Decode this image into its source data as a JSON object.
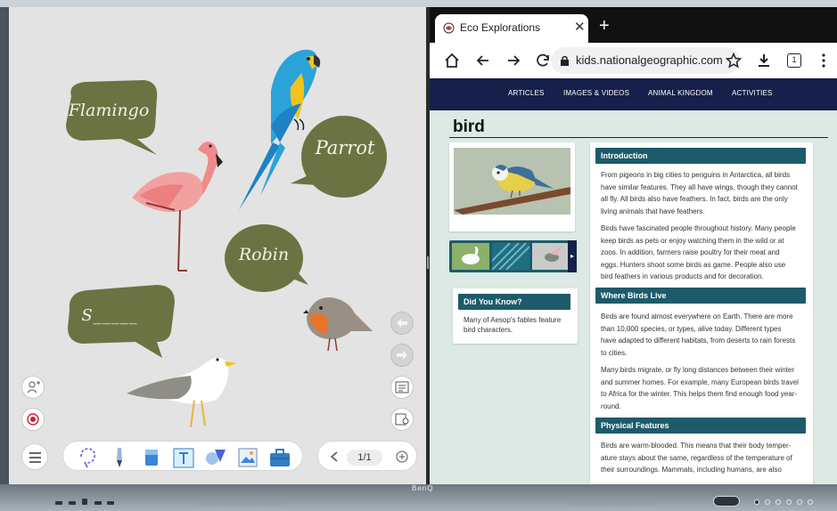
{
  "whiteboard": {
    "bubbles": [
      "Flamingo",
      "Parrot",
      "Robin",
      "S_____"
    ],
    "page_indicator": "1/1",
    "colors": {
      "bubble": "#6c7343",
      "bubble_text": "#f4f1e6"
    },
    "icons": {
      "add_user": "add-user-icon",
      "record": "record-icon",
      "undo": "undo-icon",
      "redo": "redo-icon",
      "reader": "reader-icon",
      "map": "map-icon",
      "menu": "menu-icon",
      "prev": "chevron-left-icon",
      "add_page": "add-page-icon"
    },
    "tools": [
      "lasso-tool",
      "pen-tool",
      "eraser-tool",
      "text-tool",
      "shape-tool",
      "image-tool",
      "toolbox-tool"
    ]
  },
  "browser": {
    "tab_title": "Eco Explorations",
    "url": "kids.nationalgeographic.com",
    "tab_count": "1",
    "nav": [
      "ARTICLES",
      "IMAGES & VIDEOS",
      "ANIMAL KINGDOM",
      "ACTIVITIES"
    ],
    "page_title": "bird",
    "did_you_know": {
      "heading": "Did You Know?",
      "text": "Many of Aesop's fables feature bird characters."
    },
    "sections": [
      {
        "heading": "Introduction",
        "paragraphs": [
          "From pigeons in big cities to penguins in Antarctica, all birds have similar features. They all have wings, though they cannot all fly. All birds also have feathers. In fact, birds are the only living animals that have feathers.",
          "Birds have fascinated people throughout history. Many people keep birds as pets or enjoy watching them in the wild or at zoos. In addition, farmers raise poultry for their meat and eggs. Hunters shoot some birds as game. People also use bird feathers in various products and for decoration."
        ]
      },
      {
        "heading": "Where Birds Live",
        "paragraphs": [
          "Birds are found almost everywhere on Earth. There are more than 10,000 species, or types, alive today. Different types have adapted to different habitats, from deserts to rain forests to cities.",
          "Many birds migrate, or fly long distances between their winter and summer homes. For example, many European birds travel to Africa for the winter. This helps them find enough food year-round."
        ]
      },
      {
        "heading": "Physical Features",
        "paragraphs": [
          "Birds are warm-blooded. This means that their body temper-ature stays about the same, regardless of the temperature of their surroundings. Mammals, including humans, are also"
        ]
      }
    ]
  },
  "device": {
    "brand": "BenQ"
  }
}
